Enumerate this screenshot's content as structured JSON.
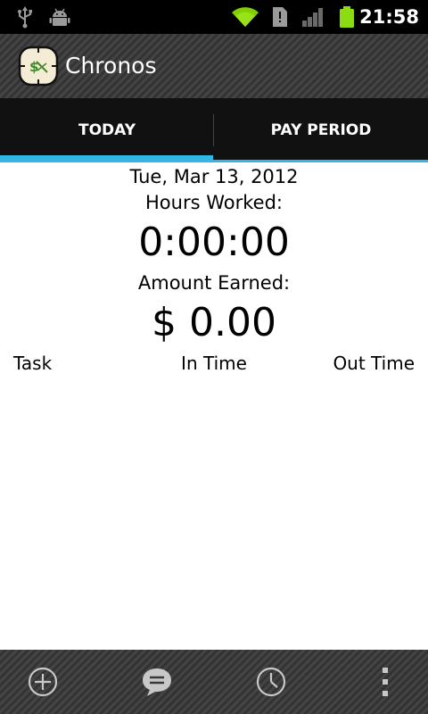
{
  "status_bar": {
    "time": "21:58",
    "icons": [
      "usb-icon",
      "android-debug-icon",
      "wifi-icon",
      "sd-card-icon",
      "signal-icon",
      "battery-icon"
    ]
  },
  "action_bar": {
    "app_title": "Chronos",
    "app_icon": "chronos-app-icon"
  },
  "tabs": [
    {
      "label": "TODAY",
      "selected": true
    },
    {
      "label": "PAY PERIOD",
      "selected": false
    }
  ],
  "accent_color": "#33b5e5",
  "today": {
    "date": "Tue, Mar 13, 2012",
    "hours_label": "Hours Worked:",
    "hours_value": "0:00:00",
    "amount_label": "Amount Earned:",
    "amount_value": "$ 0.00",
    "columns": [
      "Task",
      "In Time",
      "Out Time"
    ]
  },
  "bottom_bar": {
    "buttons": [
      "add-icon",
      "note-icon",
      "clock-icon",
      "overflow-menu-icon"
    ]
  }
}
